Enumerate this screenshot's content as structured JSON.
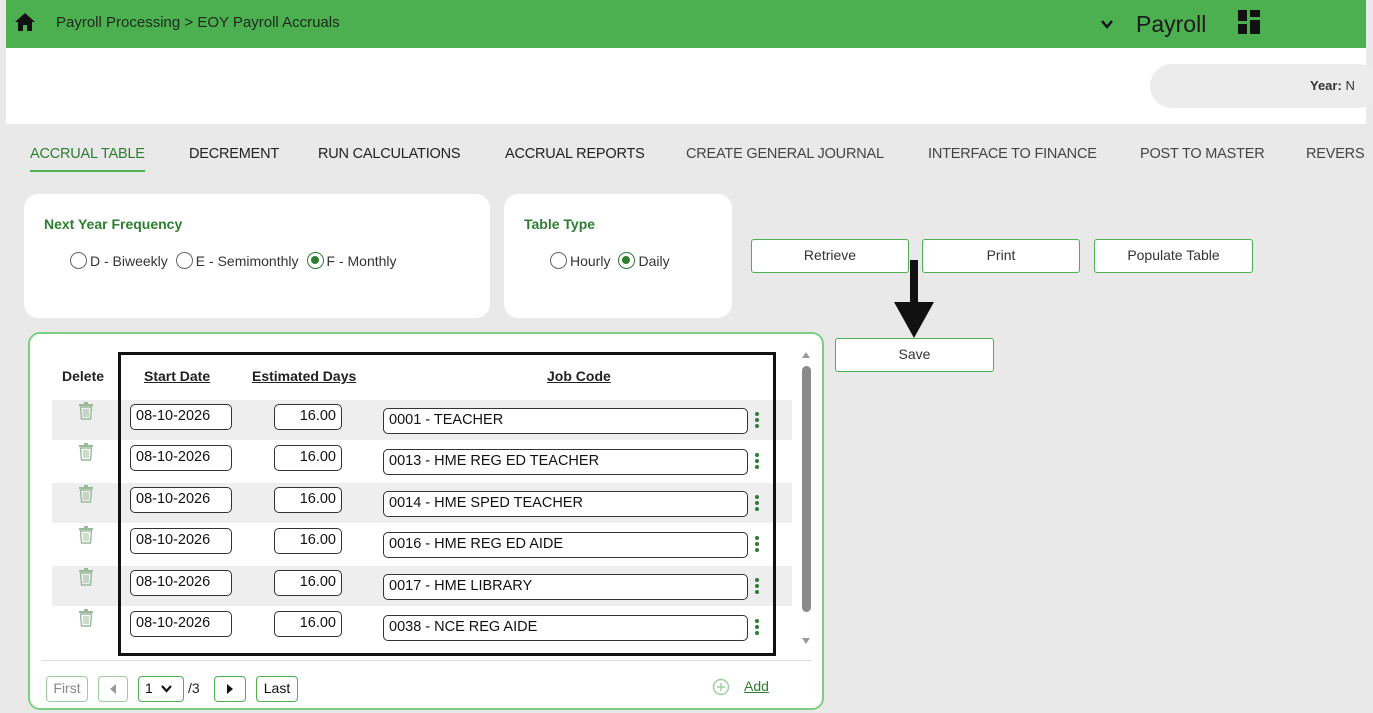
{
  "header": {
    "breadcrumb": "Payroll Processing > EOY Payroll Accruals",
    "module": "Payroll",
    "colors": {
      "bar": "#4caf50",
      "accent": "#2e7d32"
    }
  },
  "context": {
    "year_label": "Year:",
    "year_value": "N"
  },
  "tabs": [
    {
      "label": "ACCRUAL TABLE",
      "active": true
    },
    {
      "label": "DECREMENT"
    },
    {
      "label": "RUN CALCULATIONS"
    },
    {
      "label": "ACCRUAL REPORTS"
    },
    {
      "label": "CREATE GENERAL JOURNAL"
    },
    {
      "label": "INTERFACE TO FINANCE"
    },
    {
      "label": "POST TO MASTER"
    },
    {
      "label": "REVERS"
    }
  ],
  "frequency": {
    "title": "Next Year Frequency",
    "options": [
      "D - Biweekly",
      "E - Semimonthly",
      "F - Monthly"
    ],
    "selected": "F - Monthly"
  },
  "table_type": {
    "title": "Table Type",
    "options": [
      "Hourly",
      "Daily"
    ],
    "selected": "Daily"
  },
  "buttons": {
    "retrieve": "Retrieve",
    "print": "Print",
    "populate": "Populate Table",
    "save": "Save"
  },
  "grid": {
    "columns": {
      "delete": "Delete",
      "start_date": "Start Date",
      "estimated_days": "Estimated Days",
      "job_code": "Job Code"
    },
    "rows": [
      {
        "start_date": "08-10-2026",
        "days": "16.00",
        "job_code": "0001 - TEACHER"
      },
      {
        "start_date": "08-10-2026",
        "days": "16.00",
        "job_code": "0013 - HME REG ED TEACHER"
      },
      {
        "start_date": "08-10-2026",
        "days": "16.00",
        "job_code": "0014 - HME SPED TEACHER"
      },
      {
        "start_date": "08-10-2026",
        "days": "16.00",
        "job_code": "0016 - HME REG ED AIDE"
      },
      {
        "start_date": "08-10-2026",
        "days": "16.00",
        "job_code": "0017 - HME LIBRARY"
      },
      {
        "start_date": "08-10-2026",
        "days": "16.00",
        "job_code": "0038 - NCE REG AIDE"
      }
    ],
    "pager": {
      "first": "First",
      "page": "1",
      "total": "/3",
      "last": "Last",
      "add": "Add"
    }
  }
}
